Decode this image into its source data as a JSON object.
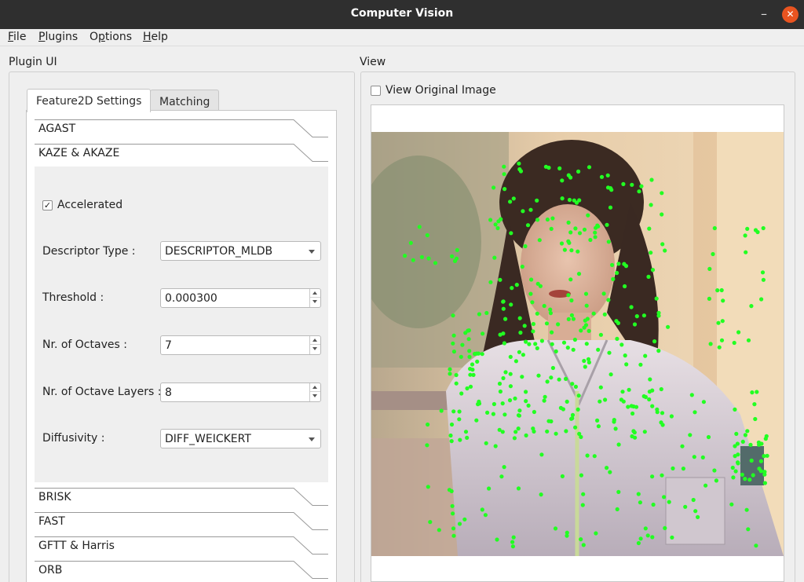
{
  "window": {
    "title": "Computer Vision",
    "minimize_glyph": "–",
    "close_glyph": "✕"
  },
  "menu": [
    {
      "acc": "F",
      "rest": "ile"
    },
    {
      "acc": "P",
      "rest": "lugins"
    },
    {
      "pre": "O",
      "acc": "p",
      "rest": "tions"
    },
    {
      "acc": "H",
      "rest": "elp"
    }
  ],
  "plugin_ui": {
    "title": "Plugin UI",
    "tabs": [
      {
        "label": "Feature2D Settings",
        "active": true
      },
      {
        "label": "Matching",
        "active": false
      }
    ],
    "toolbox_top": [
      "AGAST",
      "KAZE & AKAZE"
    ],
    "toolbox_bottom": [
      "BRISK",
      "FAST",
      "GFTT & Harris",
      "ORB"
    ],
    "kaze": {
      "accelerated": {
        "label": "Accelerated",
        "checked": true,
        "check_glyph": "✓"
      },
      "descriptor_type": {
        "label": "Descriptor Type :",
        "value": "DESCRIPTOR_MLDB"
      },
      "threshold": {
        "label": "Threshold :",
        "value": "0.000300"
      },
      "octaves": {
        "label": "Nr. of Octaves :",
        "value": "7"
      },
      "octave_layers": {
        "label": "Nr. of Octave Layers :",
        "value": "8"
      },
      "diffusivity": {
        "label": "Diffusivity :",
        "value": "DIFF_WEICKERT"
      }
    }
  },
  "view": {
    "title": "View",
    "view_original": {
      "label": "View Original Image",
      "checked": false
    },
    "keypoint_color": "#22ff22"
  }
}
